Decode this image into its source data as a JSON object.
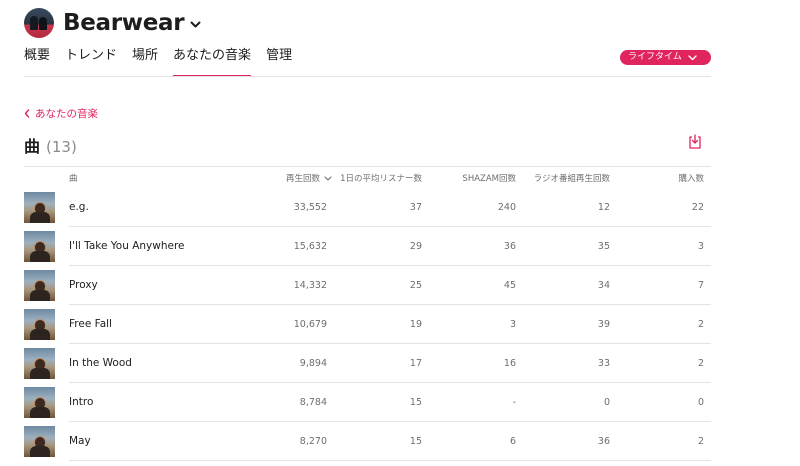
{
  "artist": {
    "name": "Bearwear"
  },
  "tabs": [
    "概要",
    "トレンド",
    "場所",
    "あなたの音楽",
    "管理"
  ],
  "active_tab": 3,
  "period": {
    "label": "ライフタイム"
  },
  "back_link": "あなたの音楽",
  "section": {
    "title": "曲",
    "count": "(13)"
  },
  "columns": {
    "song": "曲",
    "plays": "再生回数",
    "avg_listeners": "1日の平均リスナー数",
    "shazam": "SHAZAM回数",
    "radio": "ラジオ番組再生回数",
    "purchases": "購入数"
  },
  "rows": [
    {
      "title": "e.g.",
      "plays": "33,552",
      "avg_listeners": "37",
      "shazam": "240",
      "radio": "12",
      "purchases": "22"
    },
    {
      "title": "I'll Take You Anywhere",
      "plays": "15,632",
      "avg_listeners": "29",
      "shazam": "36",
      "radio": "35",
      "purchases": "3"
    },
    {
      "title": "Proxy",
      "plays": "14,332",
      "avg_listeners": "25",
      "shazam": "45",
      "radio": "34",
      "purchases": "7"
    },
    {
      "title": "Free Fall",
      "plays": "10,679",
      "avg_listeners": "19",
      "shazam": "3",
      "radio": "39",
      "purchases": "2"
    },
    {
      "title": "In the Wood",
      "plays": "9,894",
      "avg_listeners": "17",
      "shazam": "16",
      "radio": "33",
      "purchases": "2"
    },
    {
      "title": "Intro",
      "plays": "8,784",
      "avg_listeners": "15",
      "shazam": "-",
      "radio": "0",
      "purchases": "0"
    },
    {
      "title": "May",
      "plays": "8,270",
      "avg_listeners": "15",
      "shazam": "6",
      "radio": "36",
      "purchases": "2"
    }
  ],
  "colors": {
    "accent": "#e0245e",
    "text": "#1d1d1f",
    "secondary": "#6e6e73",
    "divider": "#e3e3e6"
  },
  "icons": {
    "artist_menu": "chevron-down-icon",
    "back": "chevron-left-icon",
    "export": "download-icon",
    "sort": "chevron-down-icon"
  }
}
